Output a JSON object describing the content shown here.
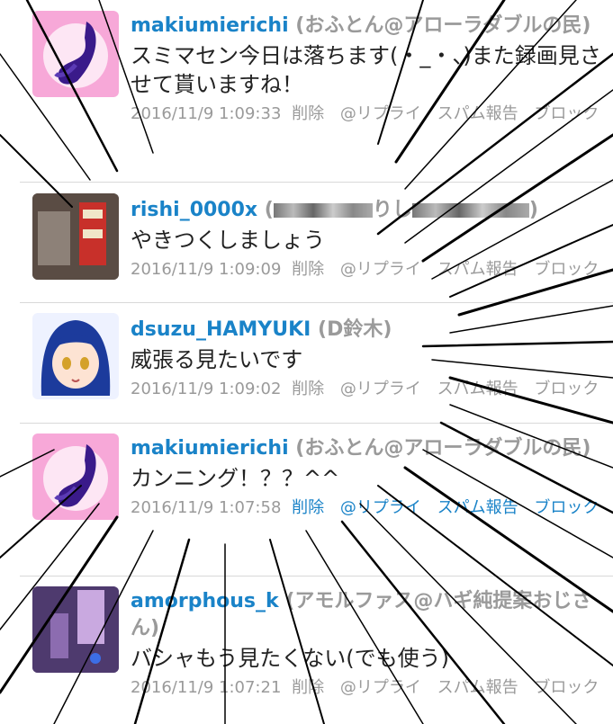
{
  "posts": [
    {
      "username": "makiumierichi",
      "display_name": "(おふとん@アローラダブルの民)",
      "message": "スミマセン今日は落ちます(・_・、)また録画見させて貰いますね！",
      "timestamp": "2016/11/9 1:09:33",
      "actions": [
        "削除",
        "@リプライ",
        "スパム報告",
        "ブロック"
      ],
      "avatar_icon": "anime-character-avatar-pink"
    },
    {
      "username": "rishi_0000x",
      "display_name": "(りし)",
      "message": "やきつくしましょう",
      "timestamp": "2016/11/9 1:09:09",
      "actions": [
        "削除",
        "@リプライ",
        "スパム報告",
        "ブロック"
      ],
      "avatar_icon": "photo-avatar-sign"
    },
    {
      "username": "dsuzu_HAMYUKI",
      "display_name": "(D鈴木)",
      "message": "威張る見たいです",
      "timestamp": "2016/11/9 1:09:02",
      "actions": [
        "削除",
        "@リプライ",
        "スパム報告",
        "ブロック"
      ],
      "avatar_icon": "anime-girl-avatar-blue-hair"
    },
    {
      "username": "makiumierichi",
      "display_name": "(おふとん@アローラダブルの民)",
      "message": "カンニング！？？^^",
      "timestamp": "2016/11/9 1:07:58",
      "actions": [
        "削除",
        "@リプライ",
        "スパム報告",
        "ブロック"
      ],
      "avatar_icon": "anime-character-avatar-pink"
    },
    {
      "username": "amorphous_k",
      "display_name": "(アモルファス@ハギ純提案おじさん)",
      "message": "バシャもう見たくない(でも使う)",
      "timestamp": "2016/11/9 1:07:21",
      "actions": [
        "削除",
        "@リプライ",
        "スパム報告",
        "ブロック"
      ],
      "avatar_icon": "photo-avatar-purple"
    }
  ],
  "colors": {
    "username": "#1a83c8",
    "muted": "#9a9a9a",
    "text": "#222222",
    "divider": "#d9d9d9"
  }
}
